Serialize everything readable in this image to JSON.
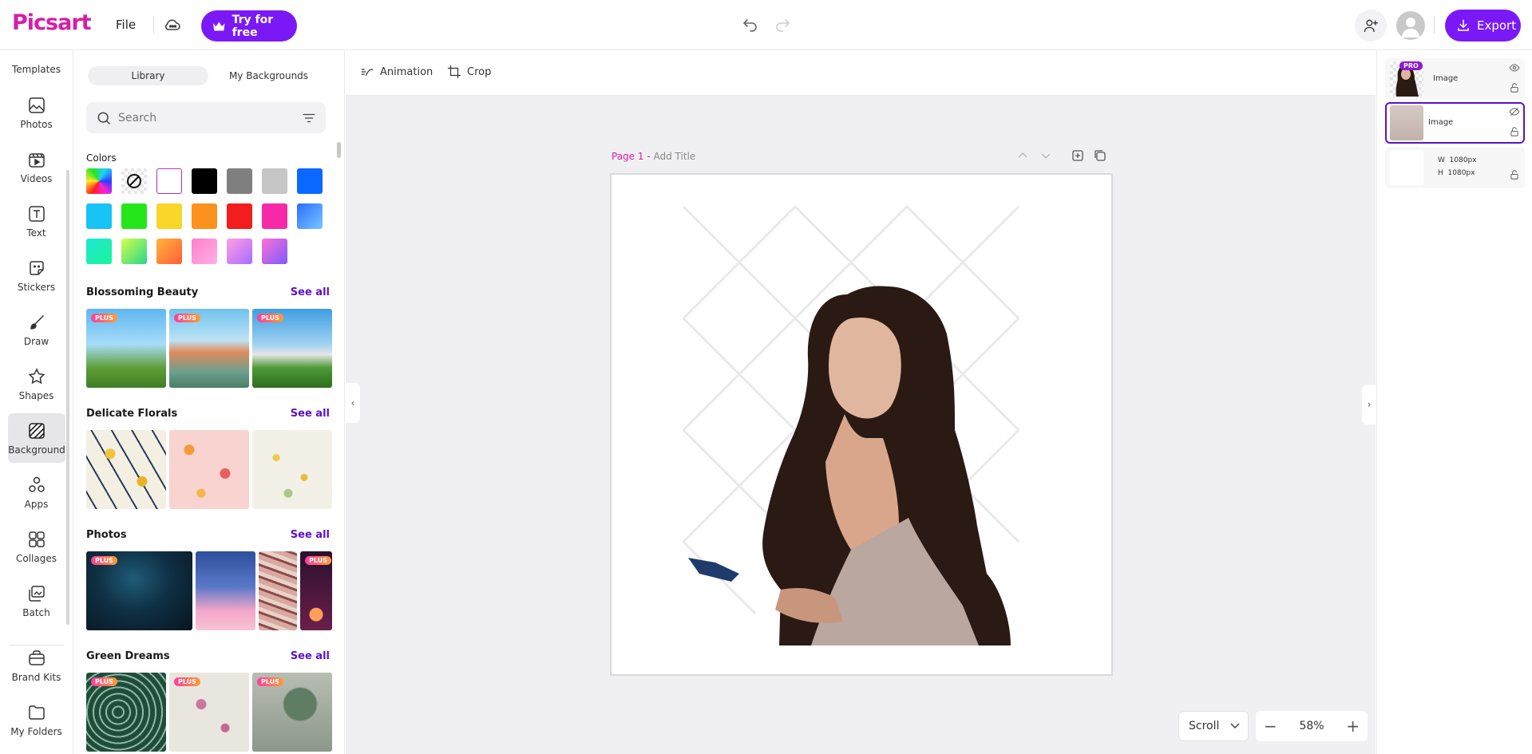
{
  "header": {
    "logo": "Picsart",
    "file_label": "File",
    "try_label": "Try for free",
    "export_label": "Export"
  },
  "rail": {
    "items": [
      {
        "label": "Templates",
        "icon": "templates-icon"
      },
      {
        "label": "Photos",
        "icon": "photos-icon"
      },
      {
        "label": "Videos",
        "icon": "videos-icon"
      },
      {
        "label": "Text",
        "icon": "text-icon"
      },
      {
        "label": "Stickers",
        "icon": "stickers-icon"
      },
      {
        "label": "Draw",
        "icon": "draw-icon"
      },
      {
        "label": "Shapes",
        "icon": "shapes-icon"
      },
      {
        "label": "Background",
        "icon": "background-icon",
        "active": true
      },
      {
        "label": "Apps",
        "icon": "apps-icon"
      },
      {
        "label": "Collages",
        "icon": "collages-icon"
      },
      {
        "label": "Batch",
        "icon": "batch-icon"
      },
      {
        "label": "Brand Kits",
        "icon": "brand-kits-icon"
      },
      {
        "label": "My Folders",
        "icon": "folders-icon"
      }
    ]
  },
  "panel": {
    "tabs": [
      "Library",
      "My Backgrounds"
    ],
    "search_placeholder": "Search",
    "colors_title": "Colors",
    "colors": [
      "rainbow",
      "none",
      "#ffffff",
      "#000000",
      "#7f7f7f",
      "#c6c6c6",
      "#0a68ff",
      "#18c3f5",
      "#25e61a",
      "#f8d62a",
      "#fb921d",
      "#f31d1d",
      "#f62aa7",
      "gradient-blue",
      "gradient-teal",
      "gradient-lime",
      "gradient-orange",
      "gradient-pink",
      "gradient-lavender",
      "gradient-violet"
    ],
    "sections": [
      {
        "title": "Blossoming Beauty",
        "see_all": "See all"
      },
      {
        "title": "Delicate Florals",
        "see_all": "See all"
      },
      {
        "title": "Photos",
        "see_all": "See all"
      },
      {
        "title": "Green Dreams",
        "see_all": "See all"
      }
    ],
    "badge": "PLUS"
  },
  "canvas": {
    "toolbar": {
      "animation": "Animation",
      "crop": "Crop"
    },
    "page_number": "Page 1 -",
    "page_title_placeholder": "Add Title",
    "scroll_mode": "Scroll",
    "zoom": "58%"
  },
  "layers": {
    "items": [
      {
        "name": "Image",
        "badge": "PRO"
      },
      {
        "name": "Image"
      }
    ],
    "background": {
      "w_label": "W",
      "w_value": "1080px",
      "h_label": "H",
      "h_value": "1080px"
    }
  }
}
